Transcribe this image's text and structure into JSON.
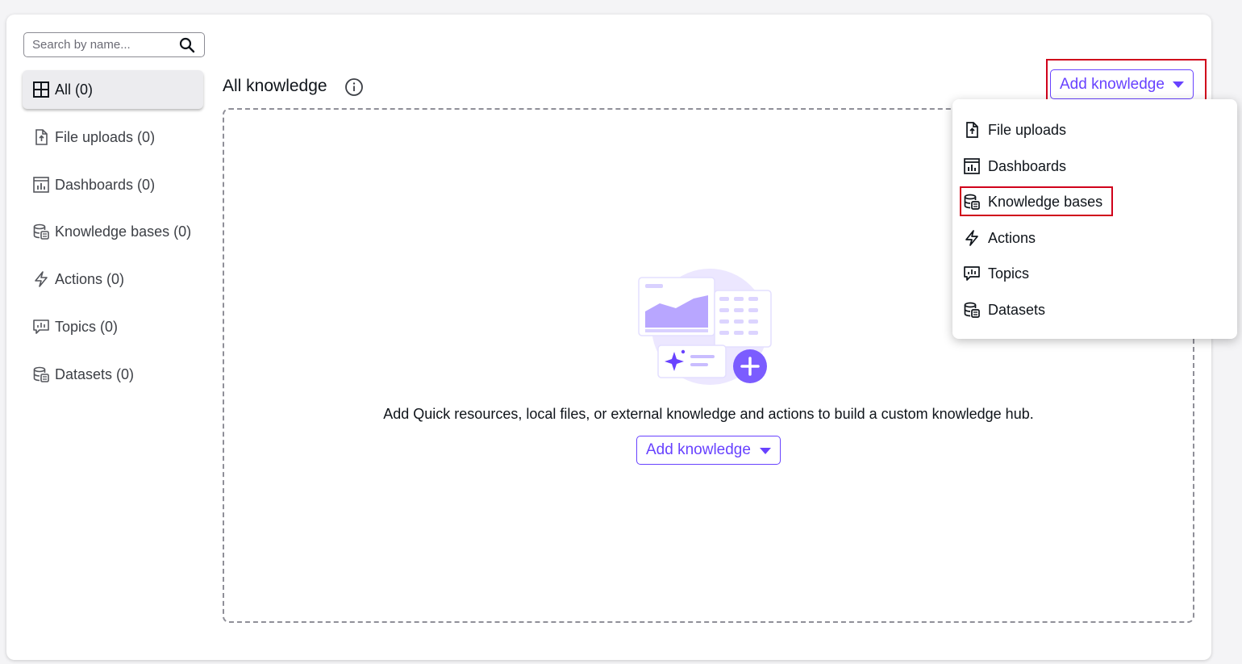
{
  "search": {
    "placeholder": "Search by name..."
  },
  "sidebar": {
    "items": [
      {
        "label": "All (0)",
        "icon": "grid-icon",
        "active": true
      },
      {
        "label": "File uploads (0)",
        "icon": "file-upload-icon"
      },
      {
        "label": "Dashboards (0)",
        "icon": "dashboard-icon"
      },
      {
        "label": "Knowledge bases (0)",
        "icon": "knowledge-base-icon"
      },
      {
        "label": "Actions (0)",
        "icon": "lightning-icon"
      },
      {
        "label": "Topics (0)",
        "icon": "topic-icon"
      },
      {
        "label": "Datasets (0)",
        "icon": "dataset-icon"
      }
    ]
  },
  "main": {
    "title": "All knowledge",
    "add_button_label": "Add knowledge",
    "empty_message": "Add Quick resources, local files, or external knowledge and actions to build a custom knowledge hub."
  },
  "menu": {
    "items": [
      {
        "label": "File uploads",
        "icon": "file-upload-icon"
      },
      {
        "label": "Dashboards",
        "icon": "dashboard-icon"
      },
      {
        "label": "Knowledge bases",
        "icon": "knowledge-base-icon",
        "highlighted": true
      },
      {
        "label": "Actions",
        "icon": "lightning-icon"
      },
      {
        "label": "Topics",
        "icon": "topic-icon"
      },
      {
        "label": "Datasets",
        "icon": "dataset-icon"
      }
    ]
  },
  "colors": {
    "accent": "#6842ff",
    "highlight": "#d0021b",
    "text": "#0f141a"
  }
}
